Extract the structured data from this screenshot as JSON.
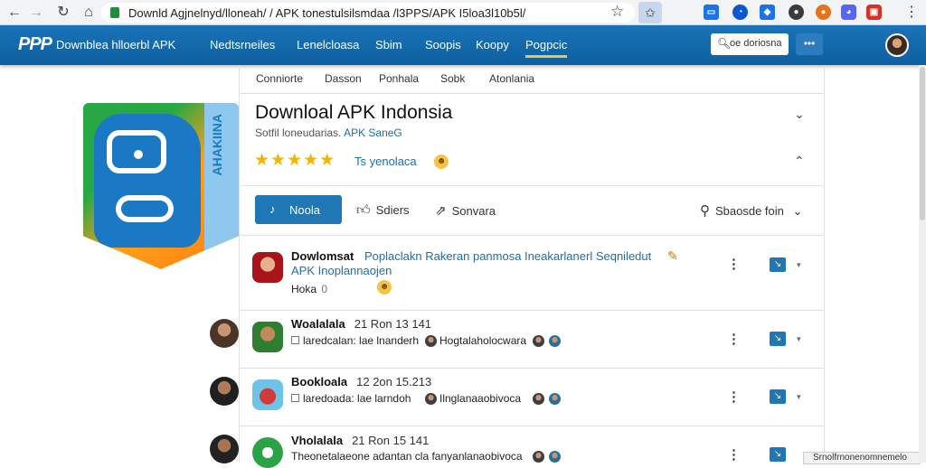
{
  "browser": {
    "url": "Downld Agjnelnyd/lloneah/ / APK tonestulsilsmdaa /l3PPS/APK I5loa3l10b5l/",
    "icons": [
      "back-arrow-icon",
      "forward-arrow-icon",
      "reload-icon",
      "home-icon",
      "lock-icon",
      "star-icon",
      "extension-icon",
      "menu-icon"
    ]
  },
  "appbar": {
    "logo": "PPP",
    "site_name": "Downblea hlloerbl APK",
    "nav": [
      "Nedtsrneiles",
      "Lenelcloasa",
      "Sbim",
      "Soopis",
      "Koopy",
      "Pogpcic"
    ],
    "active_nav": "Pogpcic",
    "search_text": "oe doriosna",
    "more_label": "•••"
  },
  "subnav": [
    "Conniorte",
    "Dasson",
    "Ponhala",
    "Sobk",
    "Atonlania"
  ],
  "app": {
    "icon_side_text": "AHAKIINA",
    "title": "Downloal APK Indonsia",
    "subtitle_prefix": "Sotfil loneudarias.",
    "subtitle_link": "APK SaneG",
    "stars": "★★★★★",
    "rating_text": "Ts yenolaca"
  },
  "toolbar": {
    "primary_label": "Noola",
    "like_label": "Sdiers",
    "share_label": "Sonvara",
    "sort_label": "Sbaosde foin"
  },
  "rows": [
    {
      "title": "Dowlomsat",
      "link": "Poplaclakn Rakeran panmosa Ineakarlanerl Seqniledut",
      "link2": "APK Inoplannaojen",
      "meta": "Hoka",
      "meta_badge": "0"
    },
    {
      "title": "Woalalala",
      "time": "21 Ron 13 141",
      "body_a": "laredcalan: lae lnanderh",
      "body_b": "Hogtalaholocwara"
    },
    {
      "title": "Bookloala",
      "time": "12 2on 15.213",
      "body_a": "laredoada: lae larndoh",
      "body_b": "Ilnglanaaobivoca"
    },
    {
      "title": "Vholalala",
      "time": "21 Ron 15 141",
      "body_a": "Theonetalaeone adantan  cla  fanyanlanaobivoca"
    }
  ],
  "tooltip": "Srnolfrnonenomnemelo",
  "colors": {
    "appbar": "#1a73b8",
    "primary": "#1f77b5",
    "link": "#1a6fb0",
    "star": "#f4b400",
    "active_underline": "#f2c24a"
  }
}
